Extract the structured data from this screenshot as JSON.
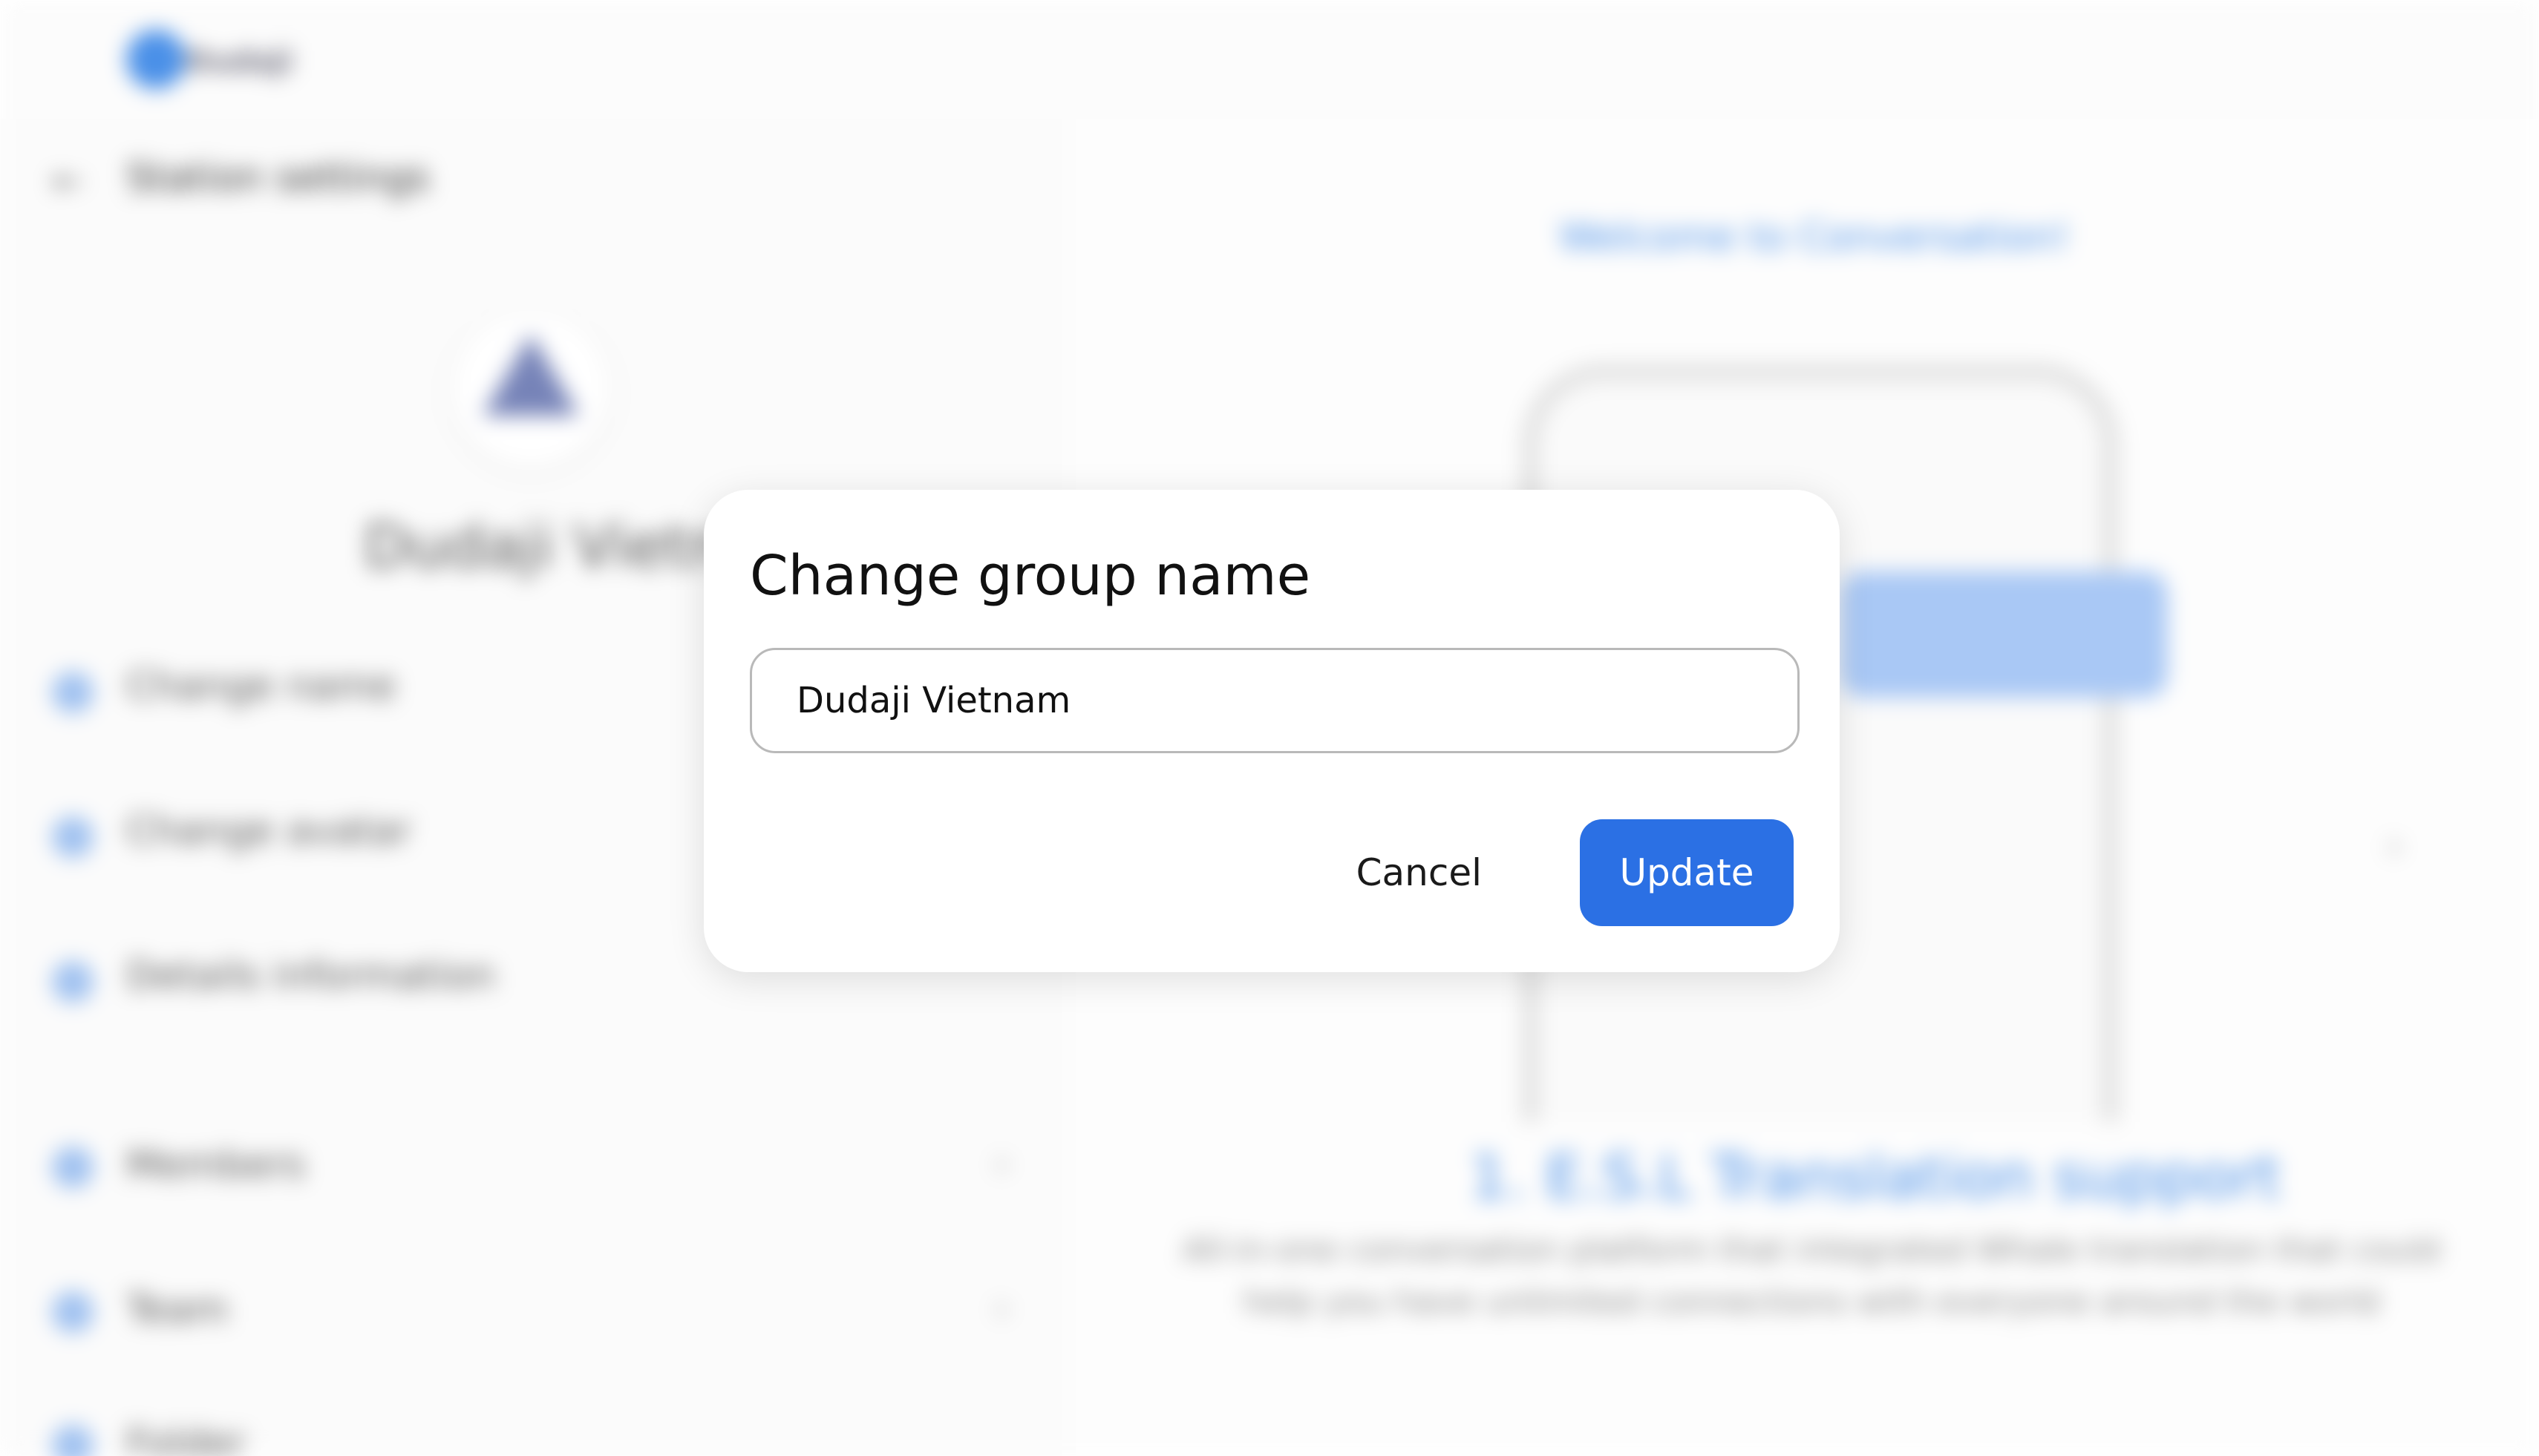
{
  "background": {
    "app_name": "Dudaji",
    "settings_title": "Station settings",
    "group_name": "Dudaji Vietnam",
    "menu_items": [
      {
        "label": "Change name",
        "icon": "pencil-icon"
      },
      {
        "label": "Change avatar",
        "icon": "image-icon"
      },
      {
        "label": "Details information",
        "icon": "info-icon"
      },
      {
        "label": "Members",
        "icon": "user-icon"
      },
      {
        "label": "Team",
        "icon": "team-icon"
      },
      {
        "label": "Folder",
        "icon": "folder-icon"
      }
    ],
    "welcome_title": "Welcome to Conversation!",
    "feature_heading": "1. E.S.L Translation support",
    "feature_desc": "All-in-one conversation platform that integrated Whale translation that could help you have unlimited connections with everyone around the world"
  },
  "dialog": {
    "title": "Change group name",
    "input_value": "Dudaji Vietnam",
    "cancel_label": "Cancel",
    "update_label": "Update"
  },
  "colors": {
    "accent": "#2b70e4",
    "dialog_bg": "#ffffff",
    "input_border": "#b9b9b9"
  }
}
